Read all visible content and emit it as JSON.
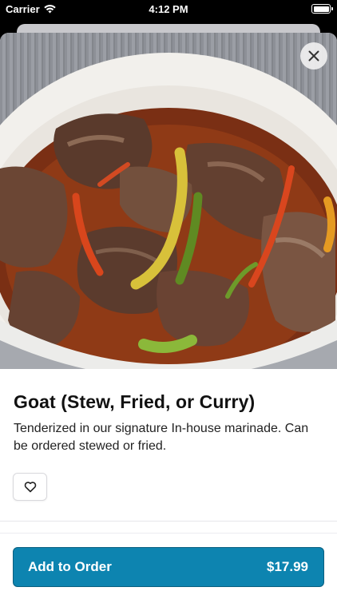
{
  "status_bar": {
    "carrier": "Carrier",
    "time": "4:12 PM"
  },
  "item": {
    "name": "Goat (Stew, Fried, or Curry)",
    "description": "Tenderized in our signature In-house marinade. Can be ordered stewed or fried.",
    "image_icon": "food-photo"
  },
  "actions": {
    "close_icon": "close-icon",
    "favorite_icon": "heart-icon"
  },
  "footer": {
    "add_label": "Add to Order",
    "price": "$17.99"
  },
  "colors": {
    "accent": "#0d84b0",
    "text": "#111111"
  }
}
